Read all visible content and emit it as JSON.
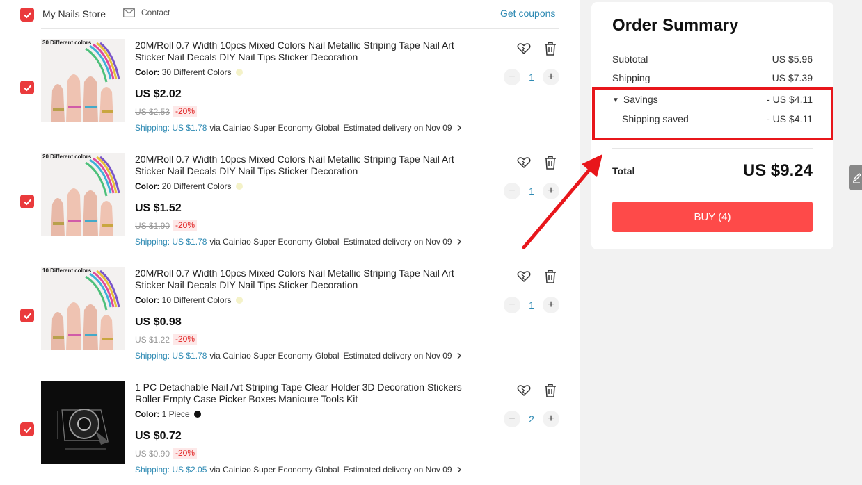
{
  "store": {
    "name": "My Nails Store",
    "contact_label": "Contact",
    "coupons_label": "Get coupons"
  },
  "items": [
    {
      "thumb_caption": "30 Different colors",
      "title": "20M/Roll 0.7 Width 10pcs Mixed Colors Nail Metallic Striping Tape Nail Art Sticker Nail Decals DIY Nail Tips Sticker Decoration",
      "color_label": "Color:",
      "color_value": "30 Different Colors",
      "swatch": "#f4f2c8",
      "price": "US $2.02",
      "old_price": "US $2.53",
      "discount": "-20%",
      "shipping_price": "Shipping: US $1.78",
      "shipping_via": "via Cainiao Super Economy Global",
      "estimated": "Estimated delivery on Nov 09",
      "quantity": "1",
      "minus_active": false
    },
    {
      "thumb_caption": "20 Different colors",
      "title": "20M/Roll 0.7 Width 10pcs Mixed Colors Nail Metallic Striping Tape Nail Art Sticker Nail Decals DIY Nail Tips Sticker Decoration",
      "color_label": "Color:",
      "color_value": "20 Different Colors",
      "swatch": "#f4f2c8",
      "price": "US $1.52",
      "old_price": "US $1.90",
      "discount": "-20%",
      "shipping_price": "Shipping: US $1.78",
      "shipping_via": "via Cainiao Super Economy Global",
      "estimated": "Estimated delivery on Nov 09",
      "quantity": "1",
      "minus_active": false
    },
    {
      "thumb_caption": "10 Different colors",
      "title": "20M/Roll 0.7 Width 10pcs Mixed Colors Nail Metallic Striping Tape Nail Art Sticker Nail Decals DIY Nail Tips Sticker Decoration",
      "color_label": "Color:",
      "color_value": "10 Different Colors",
      "swatch": "#f4f2c8",
      "price": "US $0.98",
      "old_price": "US $1.22",
      "discount": "-20%",
      "shipping_price": "Shipping: US $1.78",
      "shipping_via": "via Cainiao Super Economy Global",
      "estimated": "Estimated delivery on Nov 09",
      "quantity": "1",
      "minus_active": false
    },
    {
      "thumb_caption": "",
      "title": "1 PC Detachable Nail Art Striping Tape Clear Holder 3D Decoration Stickers Roller Empty Case Picker Boxes Manicure Tools Kit",
      "color_label": "Color:",
      "color_value": "1 Piece",
      "swatch": "#111111",
      "price": "US $0.72",
      "old_price": "US $0.90",
      "discount": "-20%",
      "shipping_price": "Shipping: US $2.05",
      "shipping_via": "via Cainiao Super Economy Global",
      "estimated": "Estimated delivery on Nov 09",
      "quantity": "2",
      "minus_active": true
    }
  ],
  "summary": {
    "title": "Order Summary",
    "subtotal_label": "Subtotal",
    "subtotal_value": "US $5.96",
    "shipping_label": "Shipping",
    "shipping_value": "US $7.39",
    "savings_label": "Savings",
    "savings_value": "- US $4.11",
    "shipping_saved_label": "Shipping saved",
    "shipping_saved_value": "- US $4.11",
    "total_label": "Total",
    "total_value": "US $9.24",
    "buy_label": "BUY (4)"
  },
  "colors": {
    "accent": "#fe4a49",
    "checkbox": "#ea3a3c",
    "link": "#2e8ab3",
    "annotation": "#e8161b"
  }
}
